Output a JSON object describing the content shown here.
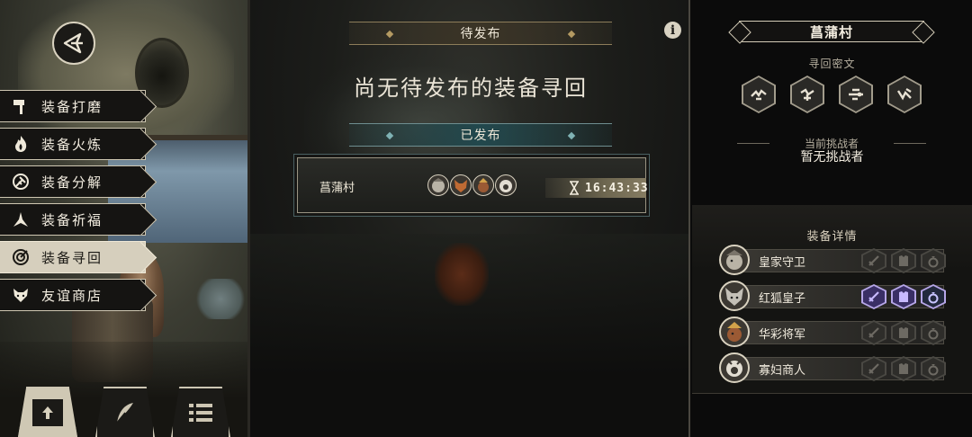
{
  "left_menu": {
    "items": [
      {
        "label": "装备打磨",
        "icon": "hammer-icon"
      },
      {
        "label": "装备火炼",
        "icon": "flame-icon"
      },
      {
        "label": "装备分解",
        "icon": "break-icon"
      },
      {
        "label": "装备祈福",
        "icon": "bless-icon"
      },
      {
        "label": "装备寻回",
        "icon": "retrieve-icon",
        "active": true
      },
      {
        "label": "友谊商店",
        "icon": "fox-face-icon"
      }
    ],
    "bottom_buttons": [
      {
        "icon": "upload-icon",
        "active": true
      },
      {
        "icon": "feather-icon"
      },
      {
        "icon": "list-icon"
      }
    ]
  },
  "center": {
    "pending_header": "待发布",
    "empty_message": "尚无待发布的装备寻回",
    "published_header": "已发布",
    "published_card": {
      "village": "菖蒲村",
      "avatars": [
        "royal-guard-avatar",
        "red-fox-prince-avatar",
        "general-avatar",
        "merchant-avatar"
      ],
      "timer": "16:43:33"
    },
    "info_label": "i"
  },
  "right": {
    "village_name": "菖蒲村",
    "cipher_title": "寻回密文",
    "cipher_icons": [
      "cipher-glyph-1",
      "cipher-glyph-2",
      "cipher-glyph-3",
      "cipher-glyph-4"
    ],
    "challenger_label": "当前挑战者",
    "challenger_value": "暂无挑战者",
    "details_title": "装备详情",
    "characters": [
      {
        "name": "皇家守卫",
        "equip_active": [
          false,
          false,
          false
        ]
      },
      {
        "name": "红狐皇子",
        "equip_active": [
          true,
          true,
          true
        ]
      },
      {
        "name": "华彩将军",
        "equip_active": [
          false,
          false,
          false
        ]
      },
      {
        "name": "寡妇商人",
        "equip_active": [
          false,
          false,
          false
        ]
      }
    ]
  },
  "colors": {
    "accent_teal": "#22484d",
    "accent_gold": "#8d7d5a",
    "equip_active": "#b6a6e8",
    "text_primary": "#f3ede0"
  }
}
